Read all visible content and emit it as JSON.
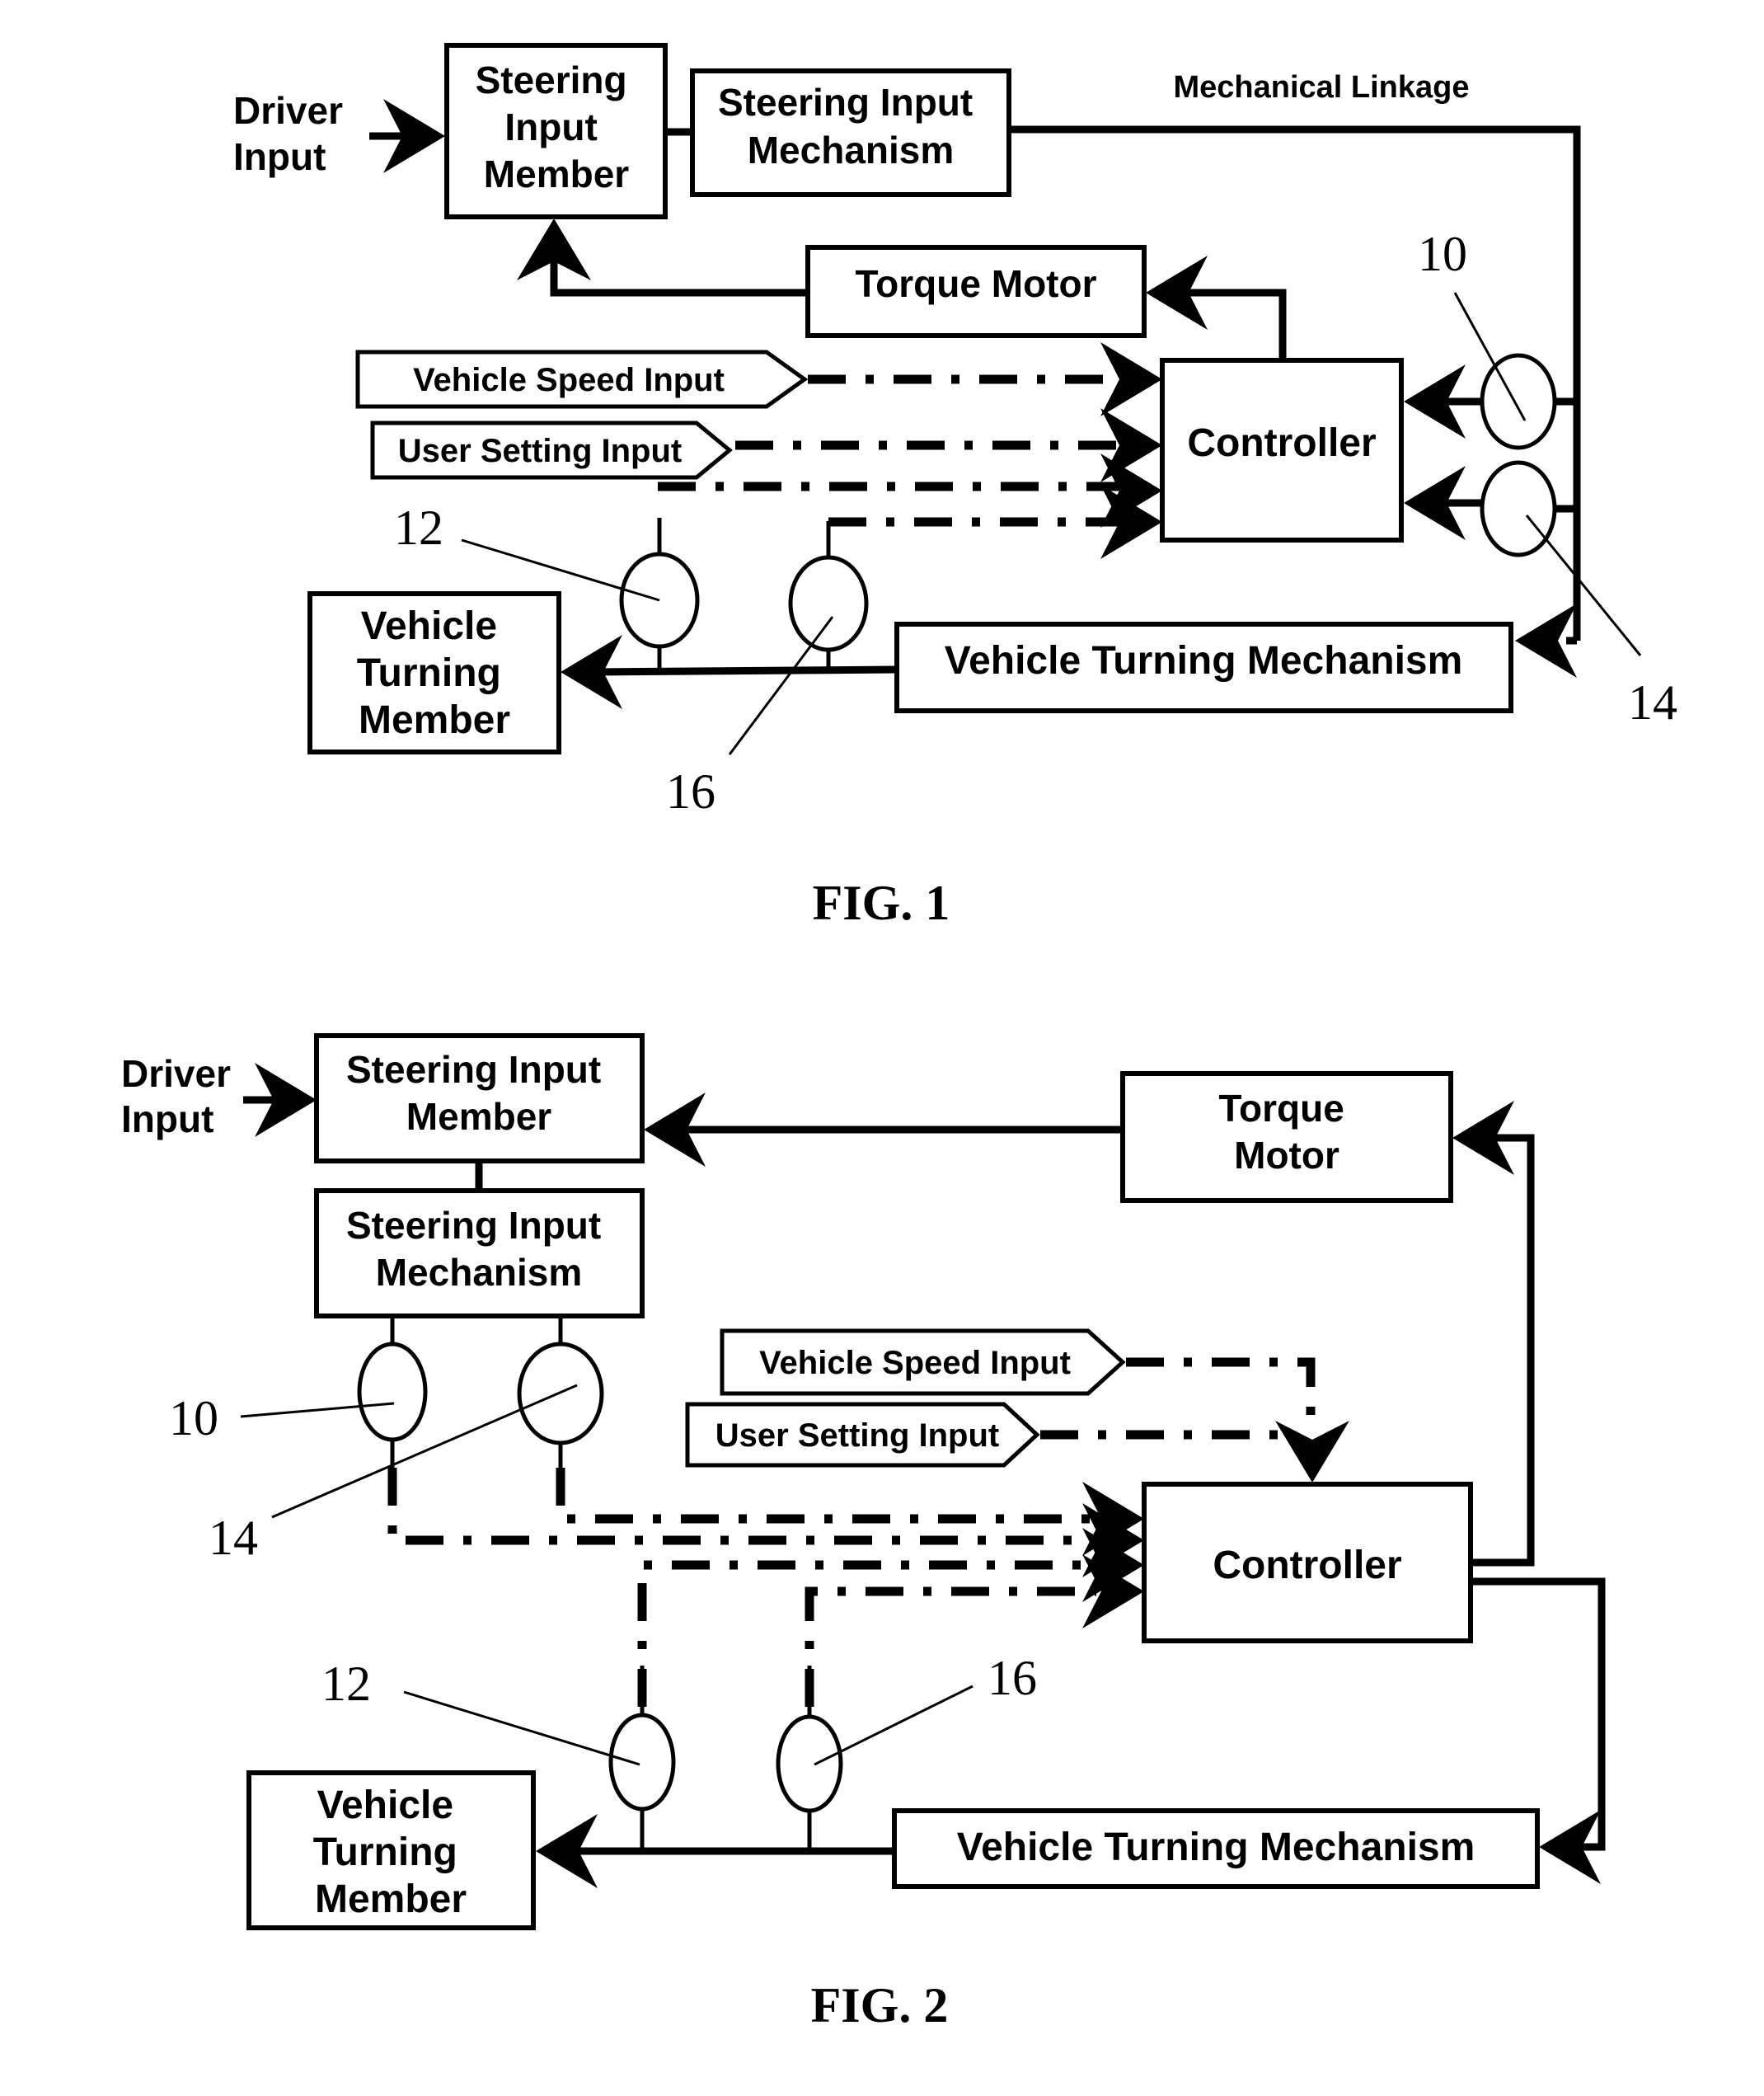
{
  "fig1": {
    "caption": "FIG. 1",
    "driver_input": [
      "Driver",
      "Input"
    ],
    "steering_input_member": [
      "Steering",
      "Input",
      "Member"
    ],
    "steering_input_mechanism": [
      "Steering Input",
      "Mechanism"
    ],
    "mechanical_linkage": "Mechanical Linkage",
    "torque_motor": "Torque Motor",
    "controller": "Controller",
    "vehicle_speed_input": "Vehicle Speed Input",
    "user_setting_input": "User Setting Input",
    "vehicle_turning_member": [
      "Vehicle",
      "Turning",
      "Member"
    ],
    "vehicle_turning_mechanism": "Vehicle Turning Mechanism",
    "refs": {
      "r10": "10",
      "r12": "12",
      "r14": "14",
      "r16": "16"
    }
  },
  "fig2": {
    "caption": "FIG. 2",
    "driver_input": [
      "Driver",
      "Input"
    ],
    "steering_input_member": [
      "Steering Input",
      "Member"
    ],
    "steering_input_mechanism": [
      "Steering Input",
      "Mechanism"
    ],
    "torque_motor": [
      "Torque",
      "Motor"
    ],
    "controller": "Controller",
    "vehicle_speed_input": "Vehicle Speed Input",
    "user_setting_input": "User Setting Input",
    "vehicle_turning_member": [
      "Vehicle",
      "Turning",
      "Member"
    ],
    "vehicle_turning_mechanism": "Vehicle Turning Mechanism",
    "refs": {
      "r10": "10",
      "r12": "12",
      "r14": "14",
      "r16": "16"
    }
  }
}
